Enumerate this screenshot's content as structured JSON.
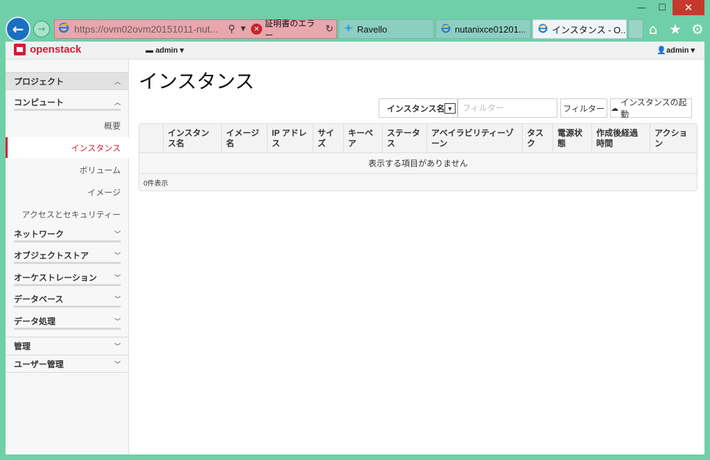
{
  "window": {
    "minimize": "—",
    "maximize": "☐",
    "close": "✕"
  },
  "browser": {
    "back_icon": "arrow-left-icon",
    "forward_icon": "arrow-right-icon",
    "address_url": "https://ovm02ovm20151011-nut...",
    "cert_error": "証明書のエラー",
    "tabs": [
      {
        "label": "Ravello",
        "icon": "ravello-icon"
      },
      {
        "label": "nutanixce01201...",
        "icon": "ie-icon"
      },
      {
        "label": "インスタンス - O...",
        "icon": "ie-icon"
      }
    ]
  },
  "header": {
    "brand": "openstack",
    "project_dropdown": "admin",
    "user_dropdown": "admin"
  },
  "sidebar": {
    "project": "プロジェクト",
    "compute": "コンピュート",
    "compute_items": [
      "概要",
      "インスタンス",
      "ボリューム",
      "イメージ",
      "アクセスとセキュリティー"
    ],
    "active_item": "インスタンス",
    "groups": [
      "ネットワーク",
      "オブジェクトストア",
      "オーケストレーション",
      "データベース",
      "データ処理"
    ],
    "top_sections": [
      "管理",
      "ユーザー管理"
    ]
  },
  "main": {
    "title": "インスタンス",
    "filter_select": "インスタンス名",
    "filter_placeholder": "フィルター",
    "filter_button": "フィルター",
    "launch_button": "インスタンスの起動",
    "columns": [
      "インスタンス名",
      "イメージ名",
      "IP アドレス",
      "サイズ",
      "キーペア",
      "ステータス",
      "アベイラビリティーゾーン",
      "タスク",
      "電源状態",
      "作成後経過時間",
      "アクション"
    ],
    "empty_message": "表示する項目がありません",
    "footer_count": "0件表示"
  }
}
